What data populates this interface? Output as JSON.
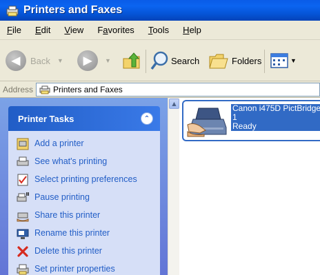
{
  "window": {
    "title": "Printers and Faxes"
  },
  "menu": [
    {
      "key": "F",
      "rest": "ile"
    },
    {
      "key": "E",
      "rest": "dit"
    },
    {
      "key": "V",
      "rest": "iew"
    },
    {
      "pre": "F",
      "key": "a",
      "rest": "vorites"
    },
    {
      "key": "T",
      "rest": "ools"
    },
    {
      "key": "H",
      "rest": "elp"
    }
  ],
  "toolbar": {
    "back_label": "Back",
    "search_label": "Search",
    "folders_label": "Folders"
  },
  "address": {
    "label": "Address",
    "value": "Printers and Faxes"
  },
  "task_panel": {
    "title": "Printer Tasks",
    "collapse_glyph": "⮝",
    "items": [
      {
        "label": "Add a printer"
      },
      {
        "label": "See what's printing"
      },
      {
        "label": "Select printing preferences"
      },
      {
        "label": "Pause printing"
      },
      {
        "label": "Share this printer"
      },
      {
        "label": "Rename this printer"
      },
      {
        "label": "Delete this printer"
      },
      {
        "label": "Set printer properties"
      }
    ]
  },
  "printer": {
    "name": "Canon i475D PictBridge",
    "jobs": "1",
    "status": "Ready"
  },
  "colors": {
    "title_bar": "#0b5ee8",
    "selection": "#316ac5",
    "task_link": "#215dc6",
    "task_pane_bg": "#7ba2e7"
  }
}
